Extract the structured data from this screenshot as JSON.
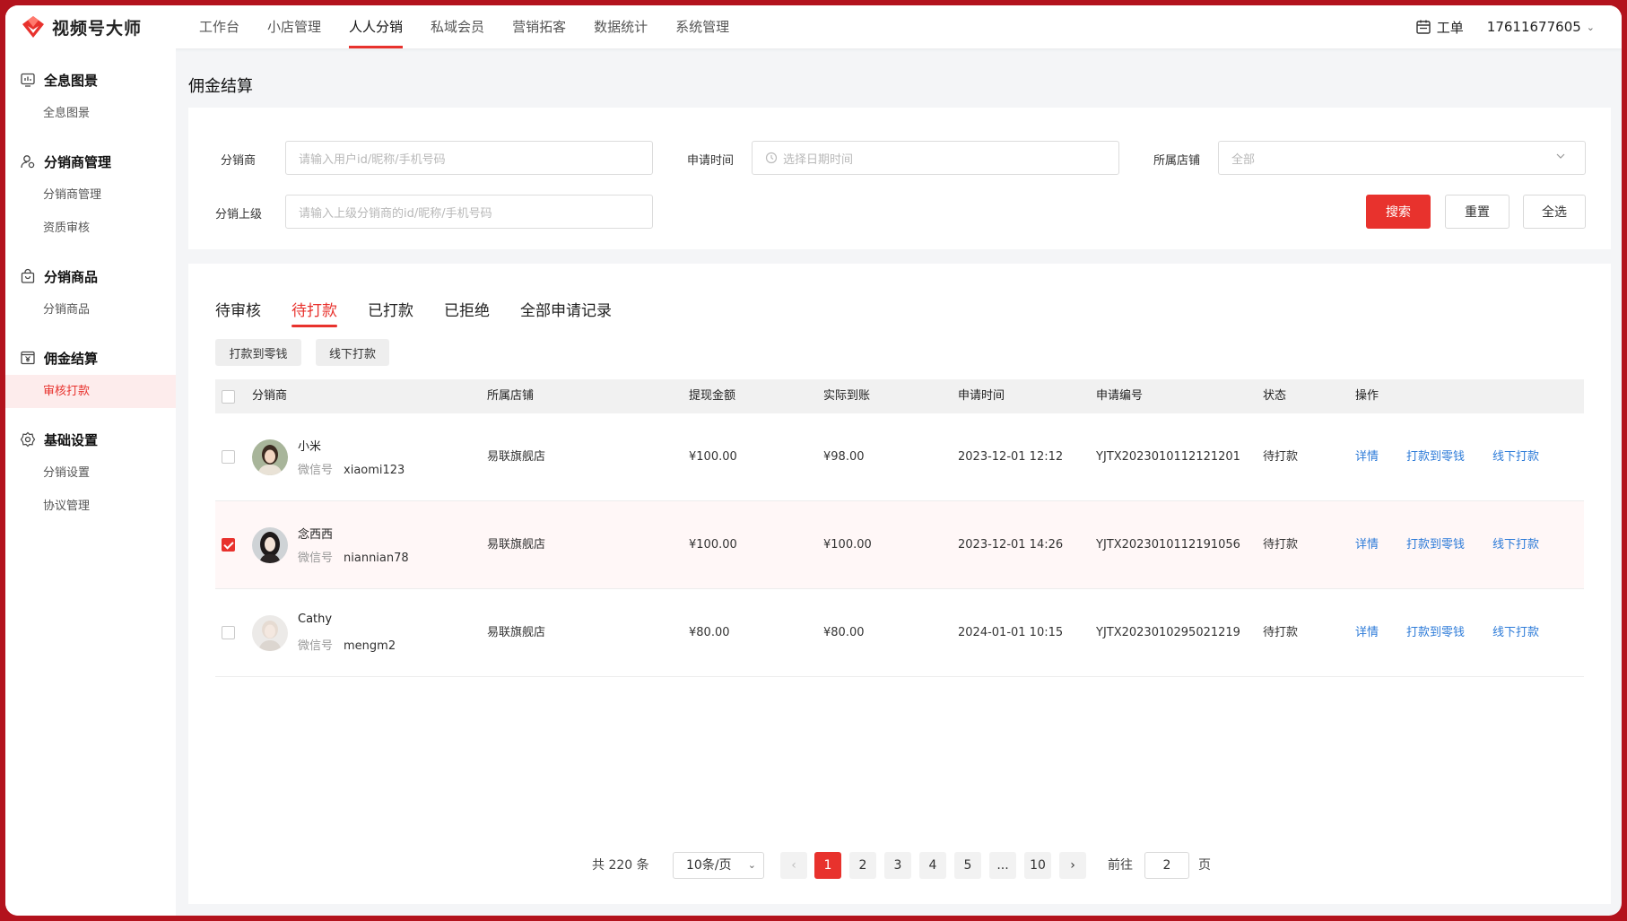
{
  "app": {
    "name": "视频号大师",
    "colors": {
      "accent": "#e8322d",
      "link": "#2d7bd8",
      "frame": "#b3131d"
    }
  },
  "topnav": {
    "items": [
      "工作台",
      "小店管理",
      "人人分销",
      "私域会员",
      "营销拓客",
      "数据统计",
      "系统管理"
    ],
    "active": "人人分销",
    "ticket_label": "工单",
    "account": "17611677605"
  },
  "sidebar": {
    "groups": [
      {
        "title": "全息图景",
        "icon": "dashboard-icon",
        "items": [
          "全息图景"
        ]
      },
      {
        "title": "分销商管理",
        "icon": "user-gear-icon",
        "items": [
          "分销商管理",
          "资质审核"
        ]
      },
      {
        "title": "分销商品",
        "icon": "shopping-bag-icon",
        "items": [
          "分销商品"
        ]
      },
      {
        "title": "佣金结算",
        "icon": "yen-icon",
        "items": [
          "审核打款"
        ]
      },
      {
        "title": "基础设置",
        "icon": "gear-icon",
        "items": [
          "分销设置",
          "协议管理"
        ]
      }
    ],
    "active_item": "审核打款"
  },
  "page": {
    "title": "佣金结算"
  },
  "filters": {
    "distributor": {
      "label": "分销商",
      "placeholder": "请输入用户id/昵称/手机号码"
    },
    "apply_time": {
      "label": "申请时间",
      "placeholder": "选择日期时间"
    },
    "store": {
      "label": "所属店铺",
      "value": "全部"
    },
    "parent": {
      "label": "分销上级",
      "placeholder": "请输入上级分销商的id/昵称/手机号码"
    },
    "search_label": "搜索",
    "reset_label": "重置",
    "select_all_label": "全选"
  },
  "tabs": [
    "待审核",
    "待打款",
    "已打款",
    "已拒绝",
    "全部申请记录"
  ],
  "active_tab": "待打款",
  "batch_actions": [
    "打款到零钱",
    "线下打款"
  ],
  "table": {
    "columns": [
      "分销商",
      "所属店铺",
      "提现金额",
      "实际到账",
      "申请时间",
      "申请编号",
      "状态",
      "操作"
    ],
    "wx_label": "微信号",
    "actions": [
      "详情",
      "打款到零钱",
      "线下打款"
    ],
    "rows": [
      {
        "name": "小米",
        "wechat": "xiaomi123",
        "store": "易联旗舰店",
        "amount": "¥100.00",
        "received": "¥98.00",
        "time": "2023-12-01 12:12",
        "code": "YJTX2023010112121201",
        "status": "待打款",
        "checked": false
      },
      {
        "name": "念西西",
        "wechat": "niannian78",
        "store": "易联旗舰店",
        "amount": "¥100.00",
        "received": "¥100.00",
        "time": "2023-12-01 14:26",
        "code": "YJTX2023010112191056",
        "status": "待打款",
        "checked": true
      },
      {
        "name": "Cathy",
        "wechat": "mengm2",
        "store": "易联旗舰店",
        "amount": "¥80.00",
        "received": "¥80.00",
        "time": "2024-01-01 10:15",
        "code": "YJTX2023010295021219",
        "status": "待打款",
        "checked": false
      }
    ]
  },
  "pagination": {
    "total_text": "共 220 条",
    "page_size": "10条/页",
    "pages": [
      "1",
      "2",
      "3",
      "4",
      "5",
      "...",
      "10"
    ],
    "current": "1",
    "goto_label": "前往",
    "goto_value": "2",
    "page_unit": "页"
  }
}
